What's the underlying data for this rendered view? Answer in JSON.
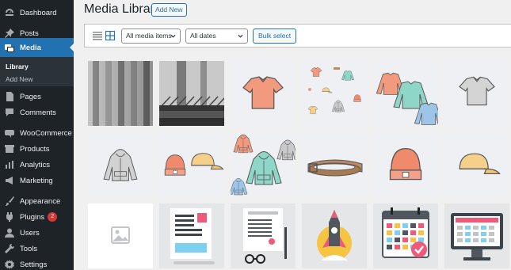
{
  "sidebar": {
    "items": [
      {
        "label": "Dashboard",
        "icon": "dashboard-icon"
      },
      {
        "label": "Posts",
        "icon": "pin-icon"
      },
      {
        "label": "Media",
        "icon": "media-icon",
        "current": true
      },
      {
        "label": "Pages",
        "icon": "page-icon"
      },
      {
        "label": "Comments",
        "icon": "comment-icon"
      },
      {
        "label": "WooCommerce",
        "icon": "woocommerce-icon"
      },
      {
        "label": "Products",
        "icon": "archive-icon"
      },
      {
        "label": "Analytics",
        "icon": "chart-icon"
      },
      {
        "label": "Marketing",
        "icon": "megaphone-icon"
      },
      {
        "label": "Appearance",
        "icon": "paintbrush-icon"
      },
      {
        "label": "Plugins",
        "icon": "plugin-icon",
        "badge": "2"
      },
      {
        "label": "Users",
        "icon": "users-icon"
      },
      {
        "label": "Tools",
        "icon": "wrench-icon"
      },
      {
        "label": "Settings",
        "icon": "settings-icon"
      }
    ],
    "submenu": [
      "Library",
      "Add New"
    ]
  },
  "header": {
    "title": "Media Library",
    "add_new": "Add New"
  },
  "toolbar": {
    "filter_type": "All media items",
    "filter_date": "All dates",
    "bulk_select": "Bulk select"
  },
  "media": [
    {
      "kind": "photo-bridge-1",
      "name": "bridge-photo"
    },
    {
      "kind": "photo-bridge-2",
      "name": "bridge-photo"
    },
    {
      "kind": "tshirt",
      "name": "tshirt-image"
    },
    {
      "kind": "pattern",
      "name": "clothing-pattern-image"
    },
    {
      "kind": "longsleeves",
      "name": "long-sleeve-image"
    },
    {
      "kind": "grey-tshirt",
      "name": "grey-tshirt-image"
    },
    {
      "kind": "grey-hoodie",
      "name": "hoodie-image"
    },
    {
      "kind": "beanie-cap",
      "name": "beanie-cap-image"
    },
    {
      "kind": "hoodies",
      "name": "hoodies-image"
    },
    {
      "kind": "belt",
      "name": "belt-image"
    },
    {
      "kind": "beanie",
      "name": "beanie-image"
    },
    {
      "kind": "cap",
      "name": "cap-image"
    },
    {
      "kind": "placeholder",
      "name": "placeholder-image"
    },
    {
      "kind": "doc1",
      "name": "document-illustration"
    },
    {
      "kind": "doc2",
      "name": "certificate-illustration"
    },
    {
      "kind": "rocket",
      "name": "rocket-illustration"
    },
    {
      "kind": "calendar",
      "name": "calendar-illustration"
    },
    {
      "kind": "monitor",
      "name": "monitor-illustration"
    }
  ]
}
